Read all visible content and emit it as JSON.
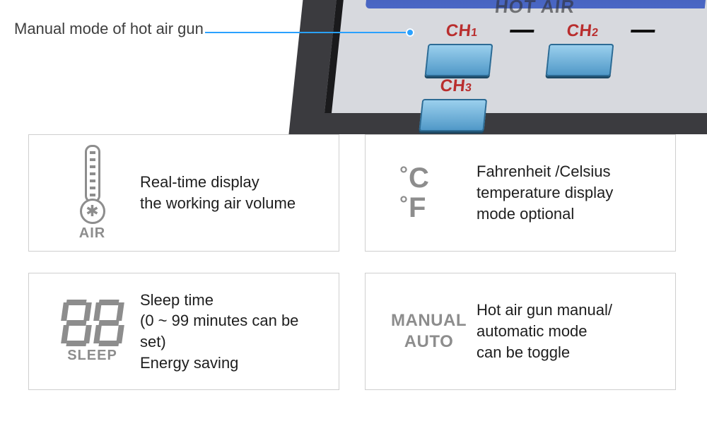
{
  "callout": {
    "text": "Manual mode of hot air gun"
  },
  "lcd": {
    "text": "HOT AIR"
  },
  "channels": [
    {
      "label_prefix": "CH",
      "label_num": "1"
    },
    {
      "label_prefix": "CH",
      "label_num": "2"
    },
    {
      "label_prefix": "CH",
      "label_num": "3"
    }
  ],
  "cards": {
    "air": {
      "caption": "AIR",
      "lines": [
        "Real-time display",
        "the working air volume"
      ]
    },
    "cf": {
      "c": "C",
      "f": "F",
      "lines": [
        "Fahrenheit /Celsius",
        "temperature display",
        "mode optional"
      ]
    },
    "sleep": {
      "caption": "SLEEP",
      "lines": [
        "Sleep time",
        "(0 ~ 99 minutes can be set)",
        "Energy saving"
      ]
    },
    "mode": {
      "line1": "MANUAL",
      "line2": "AUTO",
      "lines": [
        "Hot air gun manual/",
        "automatic mode",
        "can be toggle"
      ]
    }
  }
}
